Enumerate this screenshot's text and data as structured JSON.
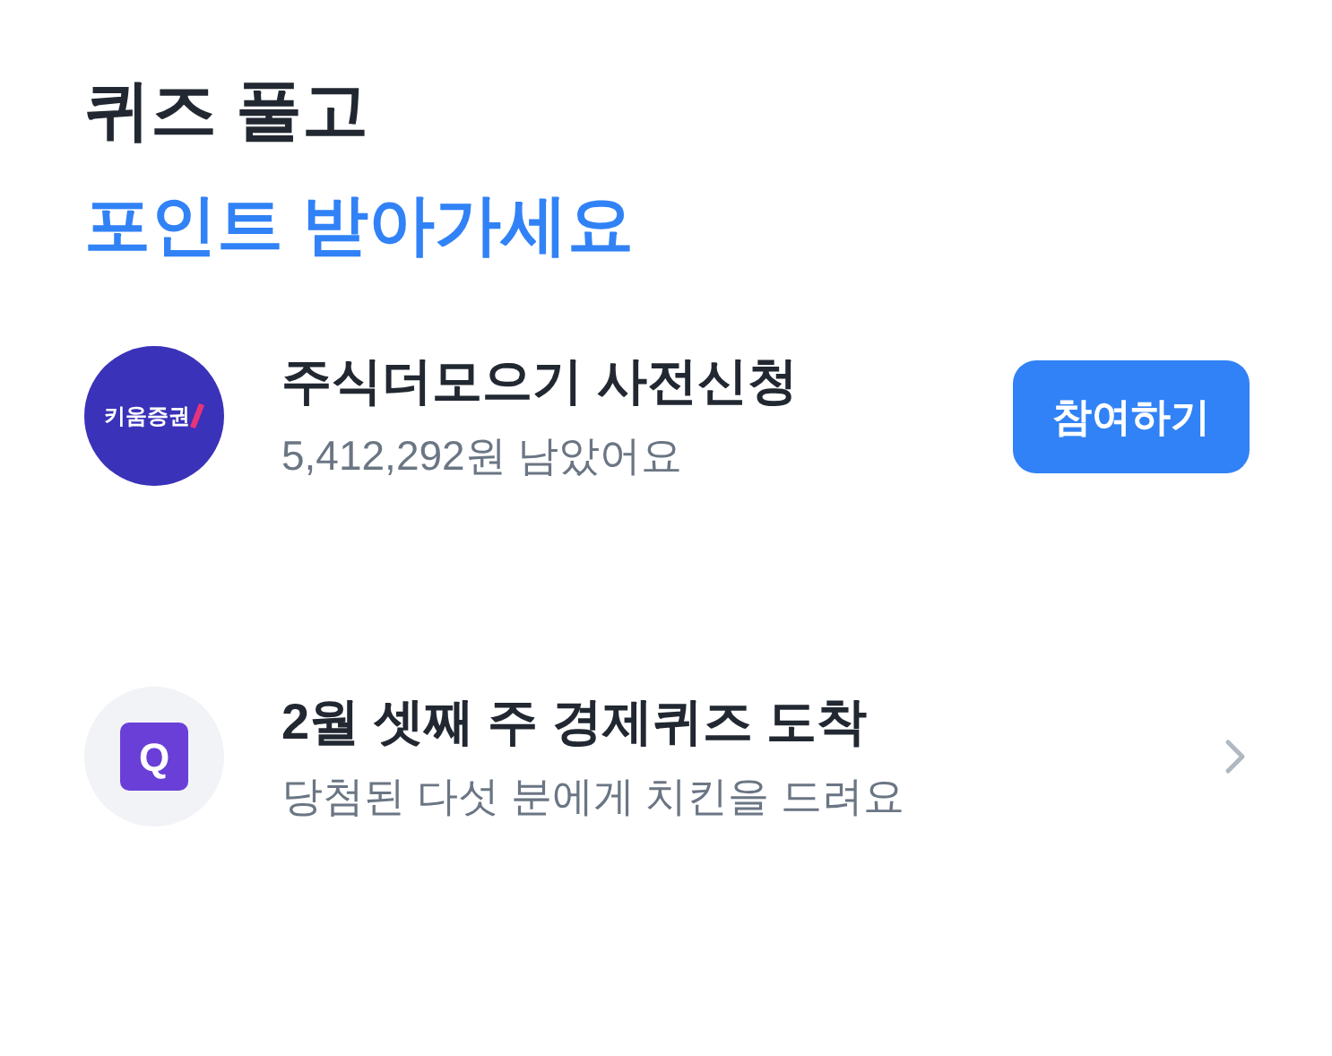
{
  "heading": {
    "line_1": "퀴즈 풀고",
    "line_2": "포인트 받아가세요"
  },
  "items": [
    {
      "kind": "button",
      "icon": {
        "kind": "brand",
        "text": "키움증권"
      },
      "title": "주식더모으기 사전신청",
      "subtitle": "5,412,292원 남았어요",
      "button": "참여하기"
    },
    {
      "kind": "chevron",
      "icon": {
        "kind": "quiz",
        "text": "Q"
      },
      "title": "2월 셋째 주 경제퀴즈 도착",
      "subtitle": "당첨된 다섯 분에게 치킨을 드려요"
    }
  ]
}
